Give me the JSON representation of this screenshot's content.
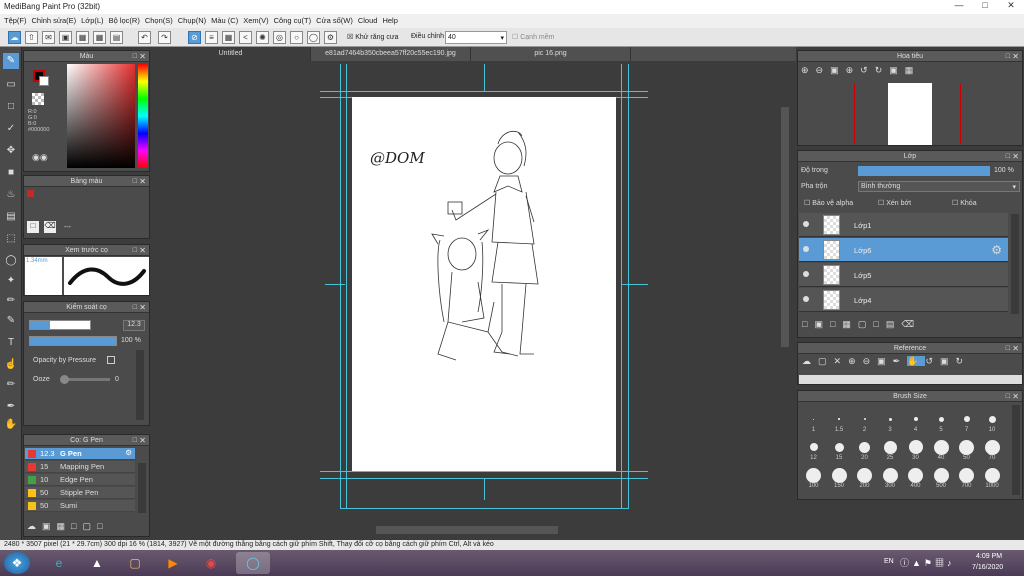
{
  "app": {
    "title": "MediBang Paint Pro (32bit)"
  },
  "menu": [
    "Tệp(F)",
    "Chỉnh sửa(E)",
    "Lớp(L)",
    "Bộ lọc(R)",
    "Chọn(S)",
    "Chụp(N)",
    "Màu (C)",
    "Xem(V)",
    "Công cụ(T)",
    "Cửa sổ(W)",
    "Cloud",
    "Help"
  ],
  "toolbar": {
    "antialias": "Khử răng cưa",
    "correction_label": "Điều chỉnh",
    "correction_value": "40",
    "snap": "Cạnh mềm"
  },
  "tabs": [
    "Untitled",
    "e81ad7464b350cbeea57ff20c55ec190.jpg",
    "pic 16.png"
  ],
  "panels": {
    "color": "Màu",
    "palette": "Bảng màu",
    "brush_preview": "Xem trước cọ",
    "brush_control": "Kiểm soát cọ",
    "brush_list": "Cọ: G Pen",
    "navigator": "Hoa tiêu",
    "layer": "Lớp",
    "reference": "Reference",
    "brush_size": "Brush Size"
  },
  "color": {
    "r": "R:0",
    "g": "G:0",
    "b": "B:0",
    "hex": "#000000",
    "fg": "#000000",
    "bg": "#ffffff"
  },
  "palette": {
    "dash": "---"
  },
  "brush_preview": {
    "size": "1.34mm"
  },
  "brush_control": {
    "size": "12.3",
    "opacity": "100 %",
    "opacity_pressure": "Opacity by Pressure",
    "ooze_label": "Ooze",
    "ooze_value": "0"
  },
  "pens": [
    {
      "size": "12.3",
      "name": "G Pen",
      "color": "#e53935"
    },
    {
      "size": "15",
      "name": "Mapping Pen",
      "color": "#e53935"
    },
    {
      "size": "10",
      "name": "Edge Pen",
      "color": "#43a047"
    },
    {
      "size": "50",
      "name": "Stipple Pen",
      "color": "#f9c11a"
    },
    {
      "size": "50",
      "name": "Sumi",
      "color": "#f9c11a"
    }
  ],
  "layer_panel": {
    "opacity_label": "Độ trong",
    "opacity_value": "100 %",
    "blend_label": "Pha trộn",
    "blend_value": "Bình thường",
    "protect_alpha": "Bảo vệ alpha",
    "clipping": "Xén bớt",
    "lock": "Khóa"
  },
  "layers": [
    {
      "name": "Lớp1"
    },
    {
      "name": "Lớp6"
    },
    {
      "name": "Lớp5"
    },
    {
      "name": "Lớp4"
    }
  ],
  "brush_sizes": [
    [
      "1",
      "1.5",
      "2",
      "3",
      "4",
      "5",
      "7",
      "10"
    ],
    [
      "12",
      "15",
      "20",
      "25",
      "30",
      "40",
      "50",
      "70"
    ],
    [
      "100",
      "150",
      "200",
      "300",
      "400",
      "500",
      "700",
      "1000"
    ]
  ],
  "canvas": {
    "sketch_text": "@DOM"
  },
  "status": {
    "dims": "2480 * 3507 pixel",
    "size": "(21 * 29.7cm)",
    "dpi": "300 dpi",
    "zoom": "16 %",
    "coords": "(1814, 3927)",
    "hint": "Vẽ một đường thẳng bằng cách giữ phím Shift, Thay đổi cỡ cọ bằng cách giữ phím Ctrl, Alt và kéo"
  },
  "taskbar": {
    "lang": "EN",
    "time": "4:09 PM",
    "date": "7/16/2020"
  }
}
